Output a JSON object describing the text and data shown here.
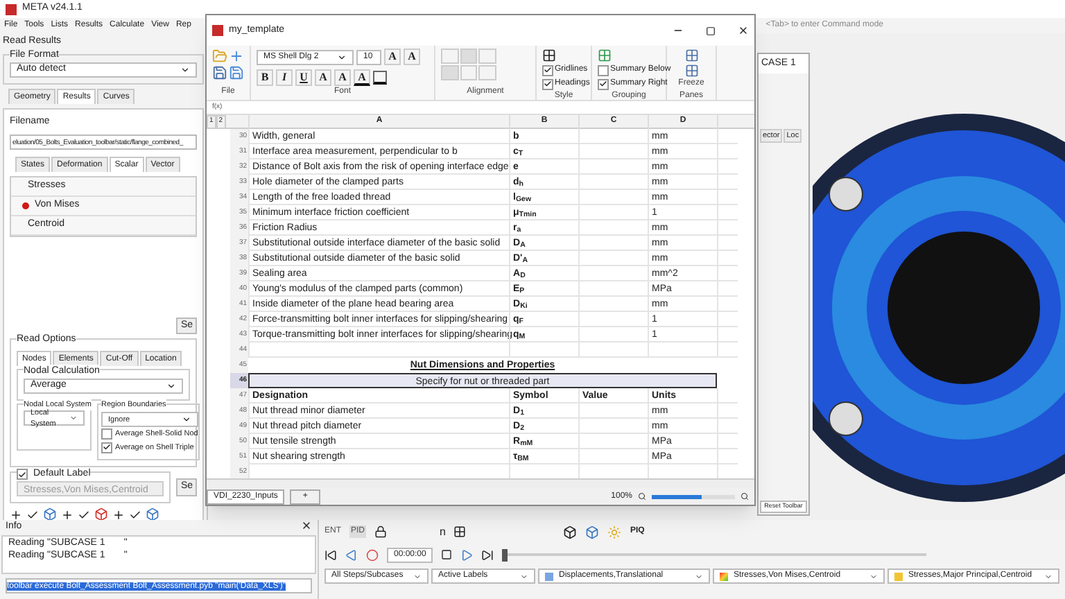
{
  "app": {
    "title": "META v24.1.1",
    "menu": [
      "File",
      "Tools",
      "Lists",
      "Results",
      "Calculate",
      "View",
      "Rep"
    ],
    "command_hint": "<Tab> to enter Command mode"
  },
  "read_results": {
    "title": "Read Results",
    "file_format": {
      "label": "File Format",
      "value": "Auto detect"
    },
    "tabs": [
      {
        "label": "Geometry",
        "selected": false
      },
      {
        "label": "Results",
        "selected": true
      },
      {
        "label": "Curves",
        "selected": false
      }
    ],
    "filename": {
      "label": "Filename",
      "value": "eluation/05_Bolts_Evaluation_toolbar/static/flange_combined_"
    },
    "subtabs": [
      {
        "label": "States",
        "selected": false
      },
      {
        "label": "Deformation",
        "selected": false
      },
      {
        "label": "Scalar",
        "selected": true
      },
      {
        "label": "Vector",
        "selected": false
      }
    ],
    "results": [
      {
        "label": "Stresses",
        "marked": false
      },
      {
        "label": "Von Mises",
        "marked": true
      },
      {
        "label": "Centroid",
        "marked": false
      }
    ],
    "select_button": "Se"
  },
  "read_options": {
    "label": "Read Options",
    "tabs": [
      {
        "label": "Nodes",
        "selected": true
      },
      {
        "label": "Elements",
        "selected": false
      },
      {
        "label": "Cut-Off",
        "selected": false
      },
      {
        "label": "Location",
        "selected": false
      }
    ],
    "nodal_calculation": {
      "label": "Nodal Calculation",
      "value": "Average"
    },
    "nodal_local_system": {
      "label": "Nodal Local System",
      "value": "Local System"
    },
    "region_boundaries": {
      "label": "Region Boundaries",
      "value": "Ignore",
      "options": [
        {
          "label": "Average Shell-Solid Nod",
          "checked": false
        },
        {
          "label": "Average on Shell Triple",
          "checked": true
        }
      ]
    }
  },
  "default_label": {
    "label": "Default Label",
    "checked": true,
    "value": "Stresses,Von Mises,Centroid",
    "button": "Se"
  },
  "info": {
    "title": "Info",
    "lines": [
      "Reading \"SUBCASE 1       \"",
      "Reading \"SUBCASE 1       \""
    ],
    "command": "toolbar execute Bolt_Assessment Bolt_Assessment.pyb \"main('Data_XLS')\""
  },
  "case_window": {
    "title": "CASE 1",
    "tabs": [
      "ector",
      "Loc"
    ],
    "reset_button": "Reset Toolbar"
  },
  "toolbar": {
    "ent": "ENT",
    "pid": "PID",
    "n": "n",
    "piq": "PIQ",
    "time": "00:00:00",
    "timeline": {
      "level": 0
    }
  },
  "status_dropdowns": [
    {
      "label": "All Steps/Subcases",
      "kind": "plain"
    },
    {
      "label": "Active Labels",
      "kind": "plain"
    },
    {
      "label": "Displacements,Translational",
      "kind": "displacement"
    },
    {
      "label": "Stresses,Von Mises,Centroid",
      "kind": "contour"
    },
    {
      "label": "Stresses,Major Principal,Centroid",
      "kind": "vector"
    }
  ],
  "sheet": {
    "title": "my_template",
    "font": "MS Shell Dlg 2",
    "size": "10",
    "style_buttons": [
      "B",
      "I",
      "U"
    ],
    "size_buttons": [
      "A",
      "A"
    ],
    "script_buttons": [
      "A",
      "A"
    ],
    "color_button": "A",
    "groups": [
      "File",
      "Font",
      "Alignment",
      "Style",
      "Grouping",
      "Freeze Panes"
    ],
    "style_checks": [
      {
        "label": "Gridlines",
        "checked": true
      },
      {
        "label": "Headings",
        "checked": true
      }
    ],
    "grouping_checks": [
      {
        "label": "Summary Below",
        "checked": false
      },
      {
        "label": "Summary Right",
        "checked": true
      }
    ],
    "fx": "f(x)",
    "levels": [
      "1",
      "2"
    ],
    "columns": [
      "A",
      "B",
      "C",
      "D"
    ],
    "rows": [
      {
        "n": "30",
        "kind": "data",
        "a": "Width, general",
        "b": "b",
        "d": "mm",
        "selected": false
      },
      {
        "n": "31",
        "kind": "data",
        "a": "Interface area measurement, perpendicular to b",
        "b": "c$_{T}$",
        "d": "mm",
        "selected": false
      },
      {
        "n": "32",
        "kind": "data",
        "a": "Distance of Bolt axis from the risk of opening interface edge",
        "b": "e",
        "d": "mm",
        "selected": false
      },
      {
        "n": "33",
        "kind": "data",
        "a": "Hole diameter of the clamped parts",
        "b": "d$_{h}$",
        "d": "mm",
        "selected": false
      },
      {
        "n": "34",
        "kind": "data",
        "a": "Length of the free loaded thread",
        "b": "l$_{Gew}$",
        "d": "mm",
        "selected": false
      },
      {
        "n": "35",
        "kind": "data",
        "a": "Minimum interface friction coefficient",
        "b": "μ$_{Tmin}$",
        "d": "1",
        "selected": false
      },
      {
        "n": "36",
        "kind": "data",
        "a": "Friction Radius",
        "b": "r$_{a}$",
        "d": "mm",
        "selected": false
      },
      {
        "n": "37",
        "kind": "data",
        "a": "Substitutional outside interface diameter of the basic solid",
        "b": "D$_{A}$",
        "d": "mm",
        "selected": false
      },
      {
        "n": "38",
        "kind": "data",
        "a": "Substitutional outside diameter of the basic solid",
        "b": "D'$_{A}$",
        "d": "mm",
        "selected": false
      },
      {
        "n": "39",
        "kind": "data",
        "a": "Sealing area",
        "b": "A$_{D}$",
        "d": "mm^2",
        "selected": false
      },
      {
        "n": "40",
        "kind": "data",
        "a": "Young's modulus of the clamped parts (common)",
        "b": "E$_{P}$",
        "d": "MPa",
        "selected": false
      },
      {
        "n": "41",
        "kind": "data",
        "a": "Inside diameter of the plane head bearing area",
        "b": "D$_{Ki}$",
        "d": "mm",
        "selected": false
      },
      {
        "n": "42",
        "kind": "data",
        "a": "Force-transmitting bolt inner interfaces for slipping/shearing",
        "b": "q$_{F}$",
        "d": "1",
        "selected": false
      },
      {
        "n": "43",
        "kind": "data",
        "a": "Torque-transmitting bolt inner interfaces for slipping/shearing",
        "b": "q$_{M}$",
        "d": "1",
        "selected": false
      },
      {
        "n": "44",
        "kind": "blank",
        "selected": false
      },
      {
        "n": "45",
        "kind": "section",
        "a": "Nut Dimensions and Properties",
        "selected": false
      },
      {
        "n": "46",
        "kind": "note",
        "a": "Specify for nut or threaded part",
        "selected": true
      },
      {
        "n": "47",
        "kind": "header",
        "a": "Designation",
        "b": "Symbol",
        "c": "Value",
        "d": "Units",
        "selected": false
      },
      {
        "n": "48",
        "kind": "data",
        "a": "Nut thread minor diameter",
        "b": "D$_{1}$",
        "d": "mm",
        "selected": false
      },
      {
        "n": "49",
        "kind": "data",
        "a": "Nut thread pitch diameter",
        "b": "D$_{2}$",
        "d": "mm",
        "selected": false
      },
      {
        "n": "50",
        "kind": "data",
        "a": "Nut tensile strength",
        "b": "R$_{mM}$",
        "d": "MPa",
        "selected": false
      },
      {
        "n": "51",
        "kind": "data",
        "a": "Nut shearing strength",
        "b": "τ$_{BM}$",
        "d": "MPa",
        "selected": false
      },
      {
        "n": "52",
        "kind": "blank",
        "selected": false
      }
    ],
    "sheet_tab": "VDI_2230_Inputs",
    "add_tab": "+",
    "zoom": {
      "label": "100%",
      "level": 0.6
    }
  }
}
